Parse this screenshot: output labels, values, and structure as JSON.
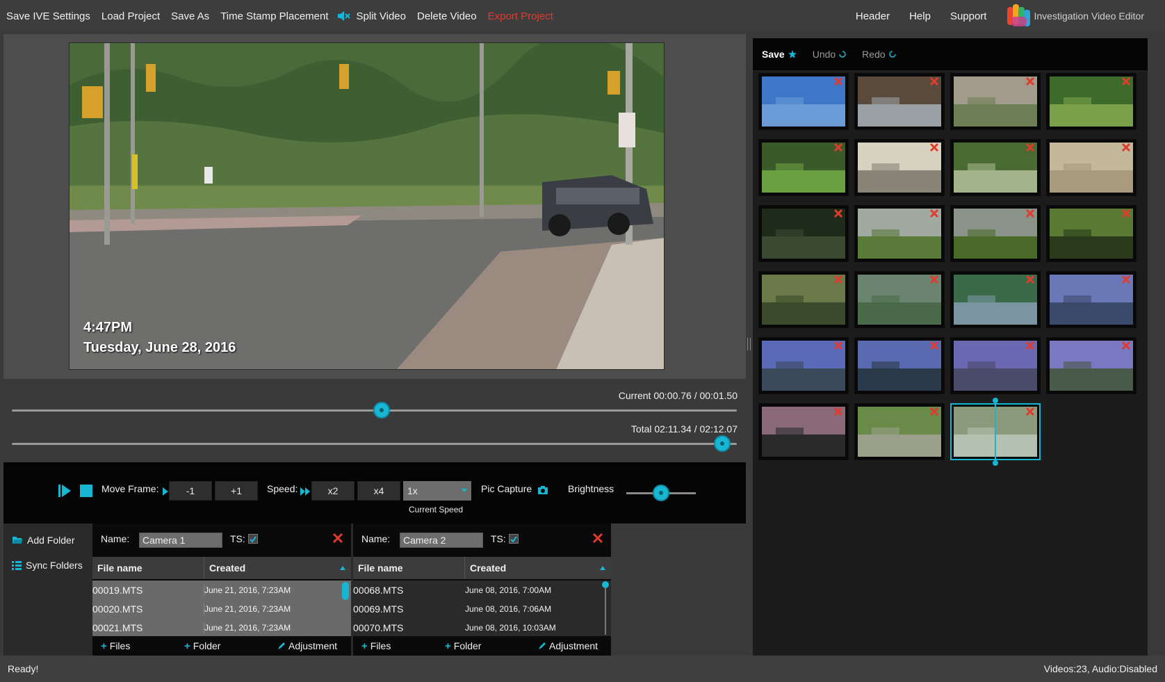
{
  "menu": {
    "items": [
      "Save IVE Settings",
      "Load Project",
      "Save As",
      "Time Stamp Placement"
    ],
    "items2": [
      "Split Video",
      "Delete Video"
    ],
    "export": "Export Project",
    "right_items": [
      "Header",
      "Help",
      "Support"
    ],
    "brand": "Investigation Video Editor"
  },
  "video": {
    "timestamp_time": "4:47PM",
    "timestamp_date": "Tuesday, June 28, 2016"
  },
  "timeline": {
    "current_label": "Current 00:00.76 / 00:01.50",
    "current_fraction": 0.51,
    "total_label": "Total 02:11.34 / 02:12.07",
    "total_fraction": 0.98
  },
  "controls": {
    "move_frame_label": "Move Frame:",
    "frame_back": "-1",
    "frame_forward": "+1",
    "speed_label": "Speed:",
    "speed_x2": "x2",
    "speed_x4": "x4",
    "speed_selected": "1x",
    "speed_caption": "Current Speed",
    "pic_capture": "Pic Capture",
    "brightness_label": "Brightness",
    "brightness_fraction": 0.5
  },
  "folders": {
    "add_folder": "Add Folder",
    "sync_folders": "Sync Folders",
    "panels": [
      {
        "name_label": "Name:",
        "name_value": "Camera 1",
        "ts_label": "TS:",
        "col_file": "File name",
        "col_created": "Created",
        "rows": [
          {
            "file": "00019.MTS",
            "created": "June 21, 2016, 7:23AM"
          },
          {
            "file": "00020.MTS",
            "created": "June 21, 2016, 7:23AM"
          },
          {
            "file": "00021.MTS",
            "created": "June 21, 2016, 7:23AM"
          }
        ],
        "files_btn": "Files",
        "folder_btn": "Folder",
        "adjust_btn": "Adjustment"
      },
      {
        "name_label": "Name:",
        "name_value": "Camera 2",
        "ts_label": "TS:",
        "col_file": "File name",
        "col_created": "Created",
        "rows": [
          {
            "file": "00068.MTS",
            "created": "June 08, 2016, 7:00AM"
          },
          {
            "file": "00069.MTS",
            "created": "June 08, 2016, 7:06AM"
          },
          {
            "file": "00070.MTS",
            "created": "June 08, 2016, 10:03AM"
          }
        ],
        "files_btn": "Files",
        "folder_btn": "Folder",
        "adjust_btn": "Adjustment"
      }
    ]
  },
  "gallery": {
    "save": "Save",
    "undo": "Undo",
    "redo": "Redo",
    "thumb_colors": [
      [
        "#3e77c8",
        "#6a9bd6"
      ],
      [
        "#5a4a3c",
        "#9aa0a4"
      ],
      [
        "#a29a8a",
        "#6f7f55"
      ],
      [
        "#3d6b2c",
        "#7aa04a"
      ],
      [
        "#3a5a2a",
        "#6aa040"
      ],
      [
        "#d8d2c0",
        "#8a8478"
      ],
      [
        "#4a6a34",
        "#a4b48a"
      ],
      [
        "#c4b89a",
        "#a89a7c"
      ],
      [
        "#1e2a1a",
        "#3a4a30"
      ],
      [
        "#a0aaa0",
        "#5a7a3a"
      ],
      [
        "#8a9488",
        "#4a6a2a"
      ],
      [
        "#5a7a34",
        "#2a3a1a"
      ],
      [
        "#6a7a4a",
        "#3a4a2a"
      ],
      [
        "#6a8470",
        "#4a6a4a"
      ],
      [
        "#3a6a4a",
        "#7a94a0"
      ],
      [
        "#6a78b8",
        "#3a4a6a"
      ],
      [
        "#5a6ab8",
        "#3a4a5a"
      ],
      [
        "#5a6ab0",
        "#2a3a4a"
      ],
      [
        "#6a68b0",
        "#4a4a6a"
      ],
      [
        "#7a78c0",
        "#4a5a4a"
      ],
      [
        "#8a6a78",
        "#2a2a2a"
      ],
      [
        "#6a8a4a",
        "#9aa08a"
      ],
      [
        "#8a9a7a",
        "#b4c0b0"
      ]
    ]
  },
  "status": {
    "left": "Ready!",
    "right": "Videos:23, Audio:Disabled"
  }
}
